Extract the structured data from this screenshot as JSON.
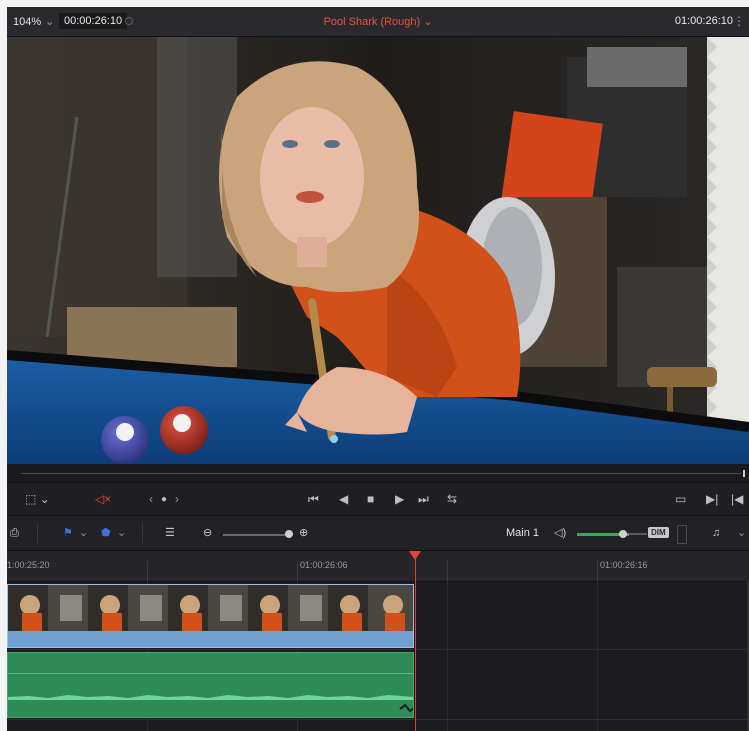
{
  "topbar": {
    "zoom": "104%",
    "timecode_left": "00:00:26:10",
    "title": "Pool Shark (Rough)",
    "timecode_right": "01:00:26:10"
  },
  "toolbar": {
    "track_label": "Main 1",
    "dim_label": "DIM"
  },
  "timeline": {
    "ruler_labels": [
      "1:00:25:20",
      "01:00:26:06",
      "01:00:26:16"
    ]
  },
  "colors": {
    "accent_red": "#e2533c",
    "video_clip": "#6fa0cf",
    "audio_clip": "#2f8c56",
    "volume_green": "#3aa856"
  },
  "icons": [
    "chevron-down-icon",
    "more-icon",
    "safe-area-icon",
    "mute-speaker-icon",
    "prev-edit-icon",
    "next-edit-icon",
    "jump-start-icon",
    "step-back-icon",
    "stop-icon",
    "play-icon",
    "jump-end-icon",
    "loop-icon",
    "match-frame-icon",
    "mark-in-icon",
    "mark-out-icon",
    "lock-icon",
    "marker-icon",
    "flag-icon",
    "clip-view-icon",
    "zoom-out-icon",
    "zoom-in-icon",
    "speaker-icon",
    "music-note-icon"
  ]
}
